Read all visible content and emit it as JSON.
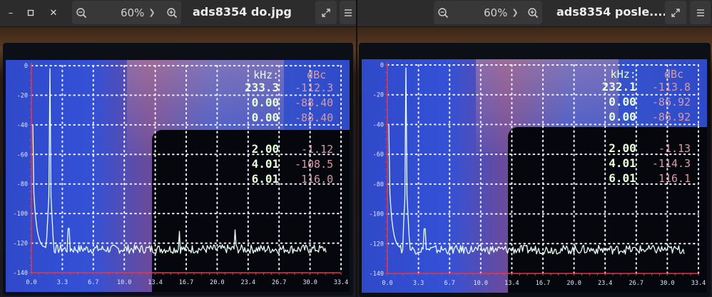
{
  "windows": [
    {
      "zoom": "60%",
      "title": "ads8354 do.jpg",
      "scope": {
        "yticks": [
          "0",
          "-20",
          "-40",
          "-60",
          "-80",
          "-100",
          "-120",
          "-140"
        ],
        "xticks": [
          "0.0",
          "3.3",
          "6.7",
          "10.0",
          "13.4",
          "16.7",
          "20.0",
          "23.4",
          "26.7",
          "30.0",
          "33.4"
        ],
        "col_khz_label": "kHz:",
        "col_dbc_label": "dBc",
        "rows": [
          {
            "khz": "233.3",
            "dbc": "-112.3"
          },
          {
            "khz": "0.00",
            "dbc": "-88.40"
          },
          {
            "khz": "0.00",
            "dbc": "-88.40"
          },
          {
            "khz": "2.00",
            "dbc": "-1.12"
          },
          {
            "khz": "4.01",
            "dbc": "-108.5"
          },
          {
            "khz": "6.01",
            "dbc": "116.0"
          }
        ]
      }
    },
    {
      "zoom": "60%",
      "title": "ads8354 posle....",
      "scope": {
        "yticks": [
          "0",
          "-20",
          "-40",
          "-60",
          "-80",
          "-100",
          "-120",
          "-140"
        ],
        "xticks": [
          "0.0",
          "3.3",
          "6.7",
          "10.0",
          "13.4",
          "16.7",
          "20.0",
          "23.4",
          "26.7",
          "30.0",
          "33.4"
        ],
        "col_khz_label": "kHz:",
        "col_dbc_label": "dBc",
        "rows": [
          {
            "khz": "232.1",
            "dbc": "-113.8"
          },
          {
            "khz": "0.00",
            "dbc": "-86.92"
          },
          {
            "khz": "0.00",
            "dbc": "-86.92"
          },
          {
            "khz": "2.00",
            "dbc": "-1.13"
          },
          {
            "khz": "4.01",
            "dbc": "-114.3"
          },
          {
            "khz": "6.01",
            "dbc": "116.1"
          }
        ]
      }
    }
  ],
  "colors": {
    "trace": "#e9fff4",
    "khz_text": "#eaffd8",
    "dbc_text": "#d79aa6",
    "grid": "#f2f2ff",
    "axis": "#e23a4a",
    "tick_text": "#dfe6ff"
  }
}
